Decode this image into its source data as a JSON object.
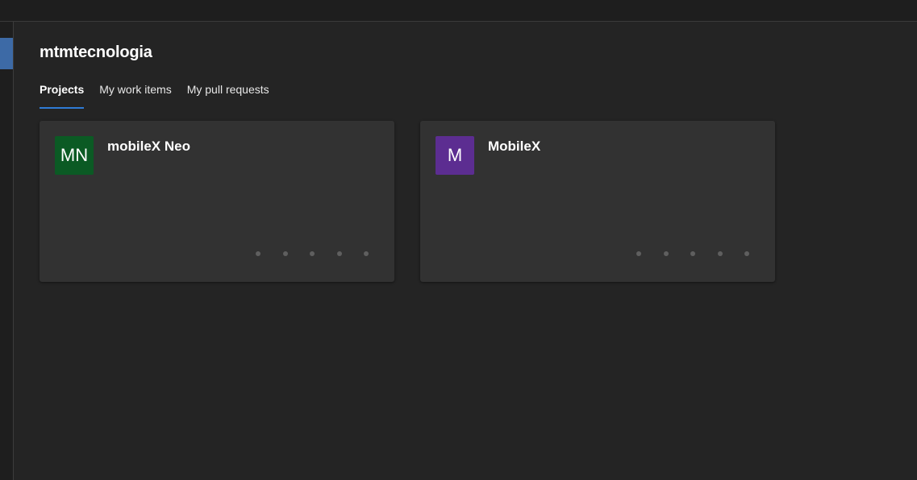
{
  "organization": {
    "name": "mtmtecnologia"
  },
  "tabs": [
    {
      "label": "Projects",
      "active": true
    },
    {
      "label": "My work items",
      "active": false
    },
    {
      "label": "My pull requests",
      "active": false
    }
  ],
  "projects": [
    {
      "name": "mobileX Neo",
      "initials": "MN",
      "avatar_color": "#0b5a24"
    },
    {
      "name": "MobileX",
      "initials": "M",
      "avatar_color": "#5c2d91"
    }
  ],
  "colors": {
    "accent": "#2f7bd6",
    "background": "#242424",
    "card": "#323232"
  }
}
